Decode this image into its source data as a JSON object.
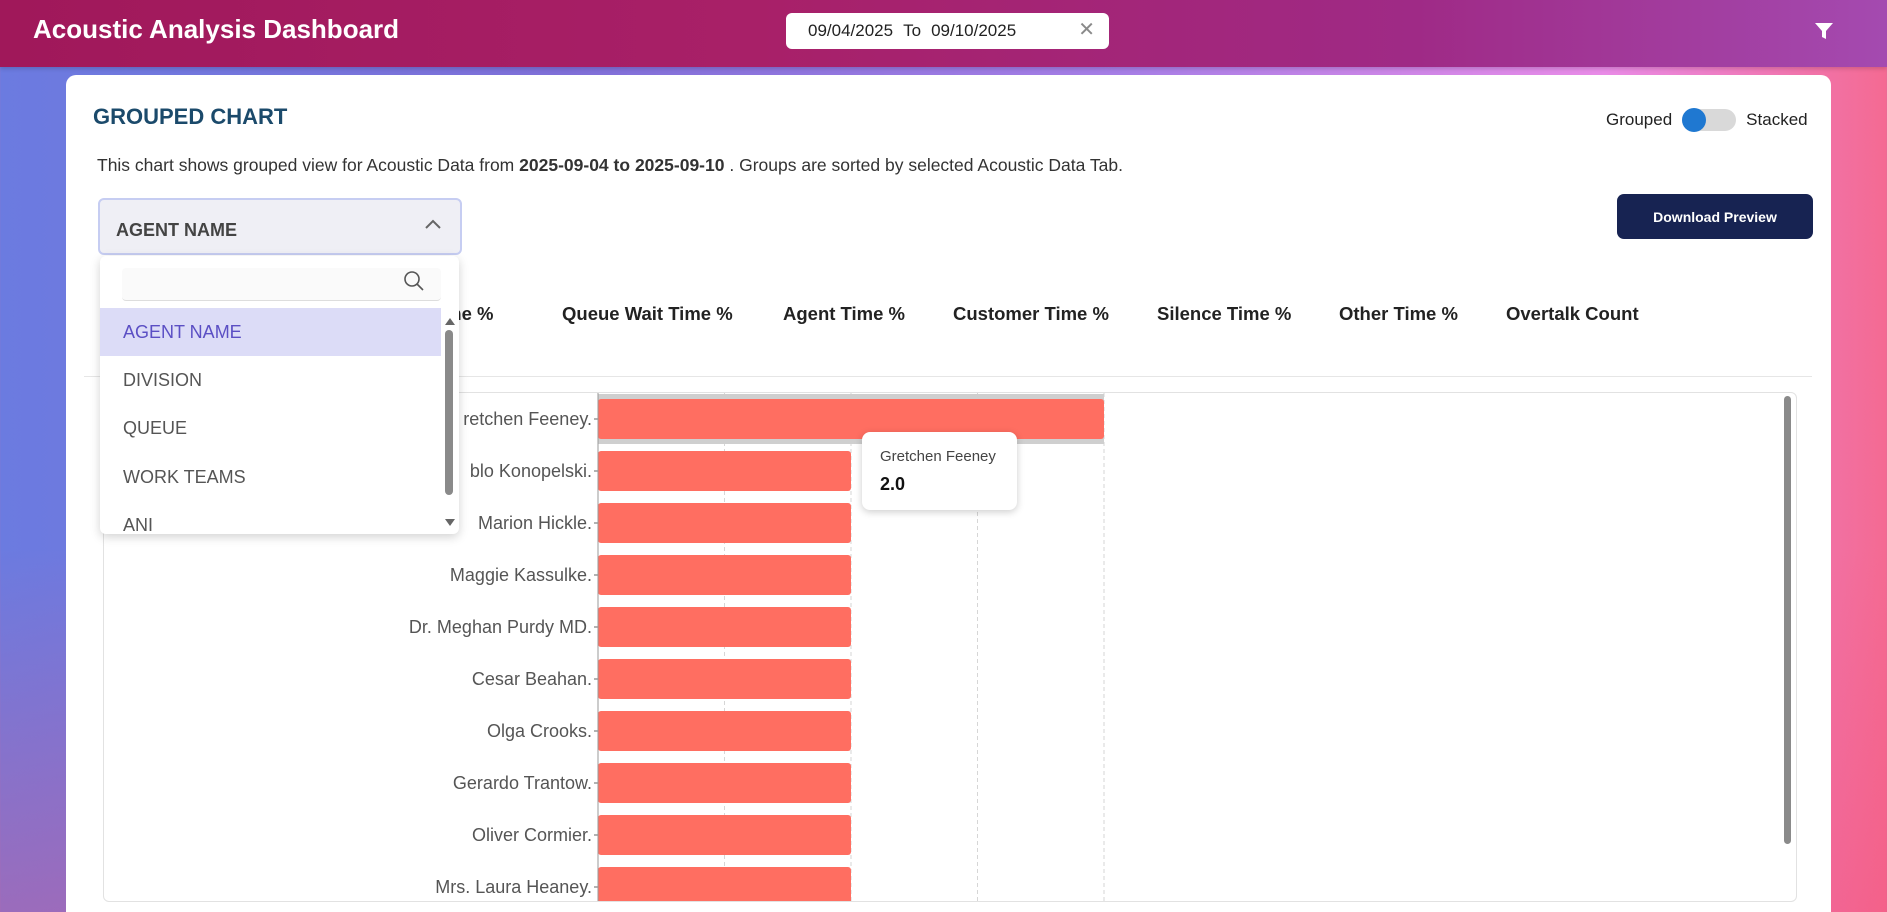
{
  "header": {
    "title": "Acoustic Analysis Dashboard",
    "date_from": "09/04/2025",
    "date_to_label": "To",
    "date_to": "09/10/2025",
    "clear_icon": "close-icon",
    "filter_icon": "filter-icon"
  },
  "card": {
    "title": "GROUPED CHART",
    "toggle": {
      "left_label": "Grouped",
      "right_label": "Stacked",
      "selected": "Grouped"
    },
    "description": {
      "prefix": "This chart shows grouped view for Acoustic Data from",
      "start": "2025-09-04",
      "middle": "to",
      "end": "2025-09-10",
      "suffix": ". Groups are sorted by selected Acoustic Data Tab."
    },
    "download_label": "Download Preview"
  },
  "group_dropdown": {
    "selected": "AGENT NAME",
    "search_placeholder": "",
    "options": [
      "AGENT NAME",
      "DIVISION",
      "QUEUE",
      "WORK TEAMS",
      "ANI"
    ]
  },
  "metric_tabs": [
    "ime %",
    "Queue Wait Time %",
    "Agent Time %",
    "Customer Time %",
    "Silence Time %",
    "Other Time %",
    "Overtalk Count"
  ],
  "tooltip": {
    "name": "Gretchen Feeney",
    "value": "2.0"
  },
  "colors": {
    "bar": "#ff6e61",
    "header_start": "#a0185a",
    "header_end": "#a44ab0",
    "accent": "#1f78d1",
    "button": "#172352"
  },
  "chart_data": {
    "type": "bar",
    "orientation": "horizontal",
    "categories": [
      "Gretchen Feeney.",
      "Pablo Konopelski.",
      "Marion Hickle.",
      "Maggie Kassulke.",
      "Dr. Meghan Purdy MD.",
      "Cesar Beahan.",
      "Olga Crooks.",
      "Gerardo Trantow.",
      "Oliver Cormier.",
      "Mrs. Laura Heaney."
    ],
    "visible_labels": [
      "retchen Feeney.",
      "blo Konopelski.",
      "Marion Hickle.",
      "Maggie Kassulke.",
      "Dr. Meghan Purdy MD.",
      "Cesar Beahan.",
      "Olga Crooks.",
      "Gerardo Trantow.",
      "Oliver Cormier.",
      "Mrs. Laura Heaney."
    ],
    "values": [
      2.0,
      1.0,
      1.0,
      1.0,
      1.0,
      1.0,
      1.0,
      1.0,
      1.0,
      1.0
    ],
    "xlim": [
      0,
      2.0
    ],
    "grid": true,
    "highlighted": "Gretchen Feeney."
  }
}
